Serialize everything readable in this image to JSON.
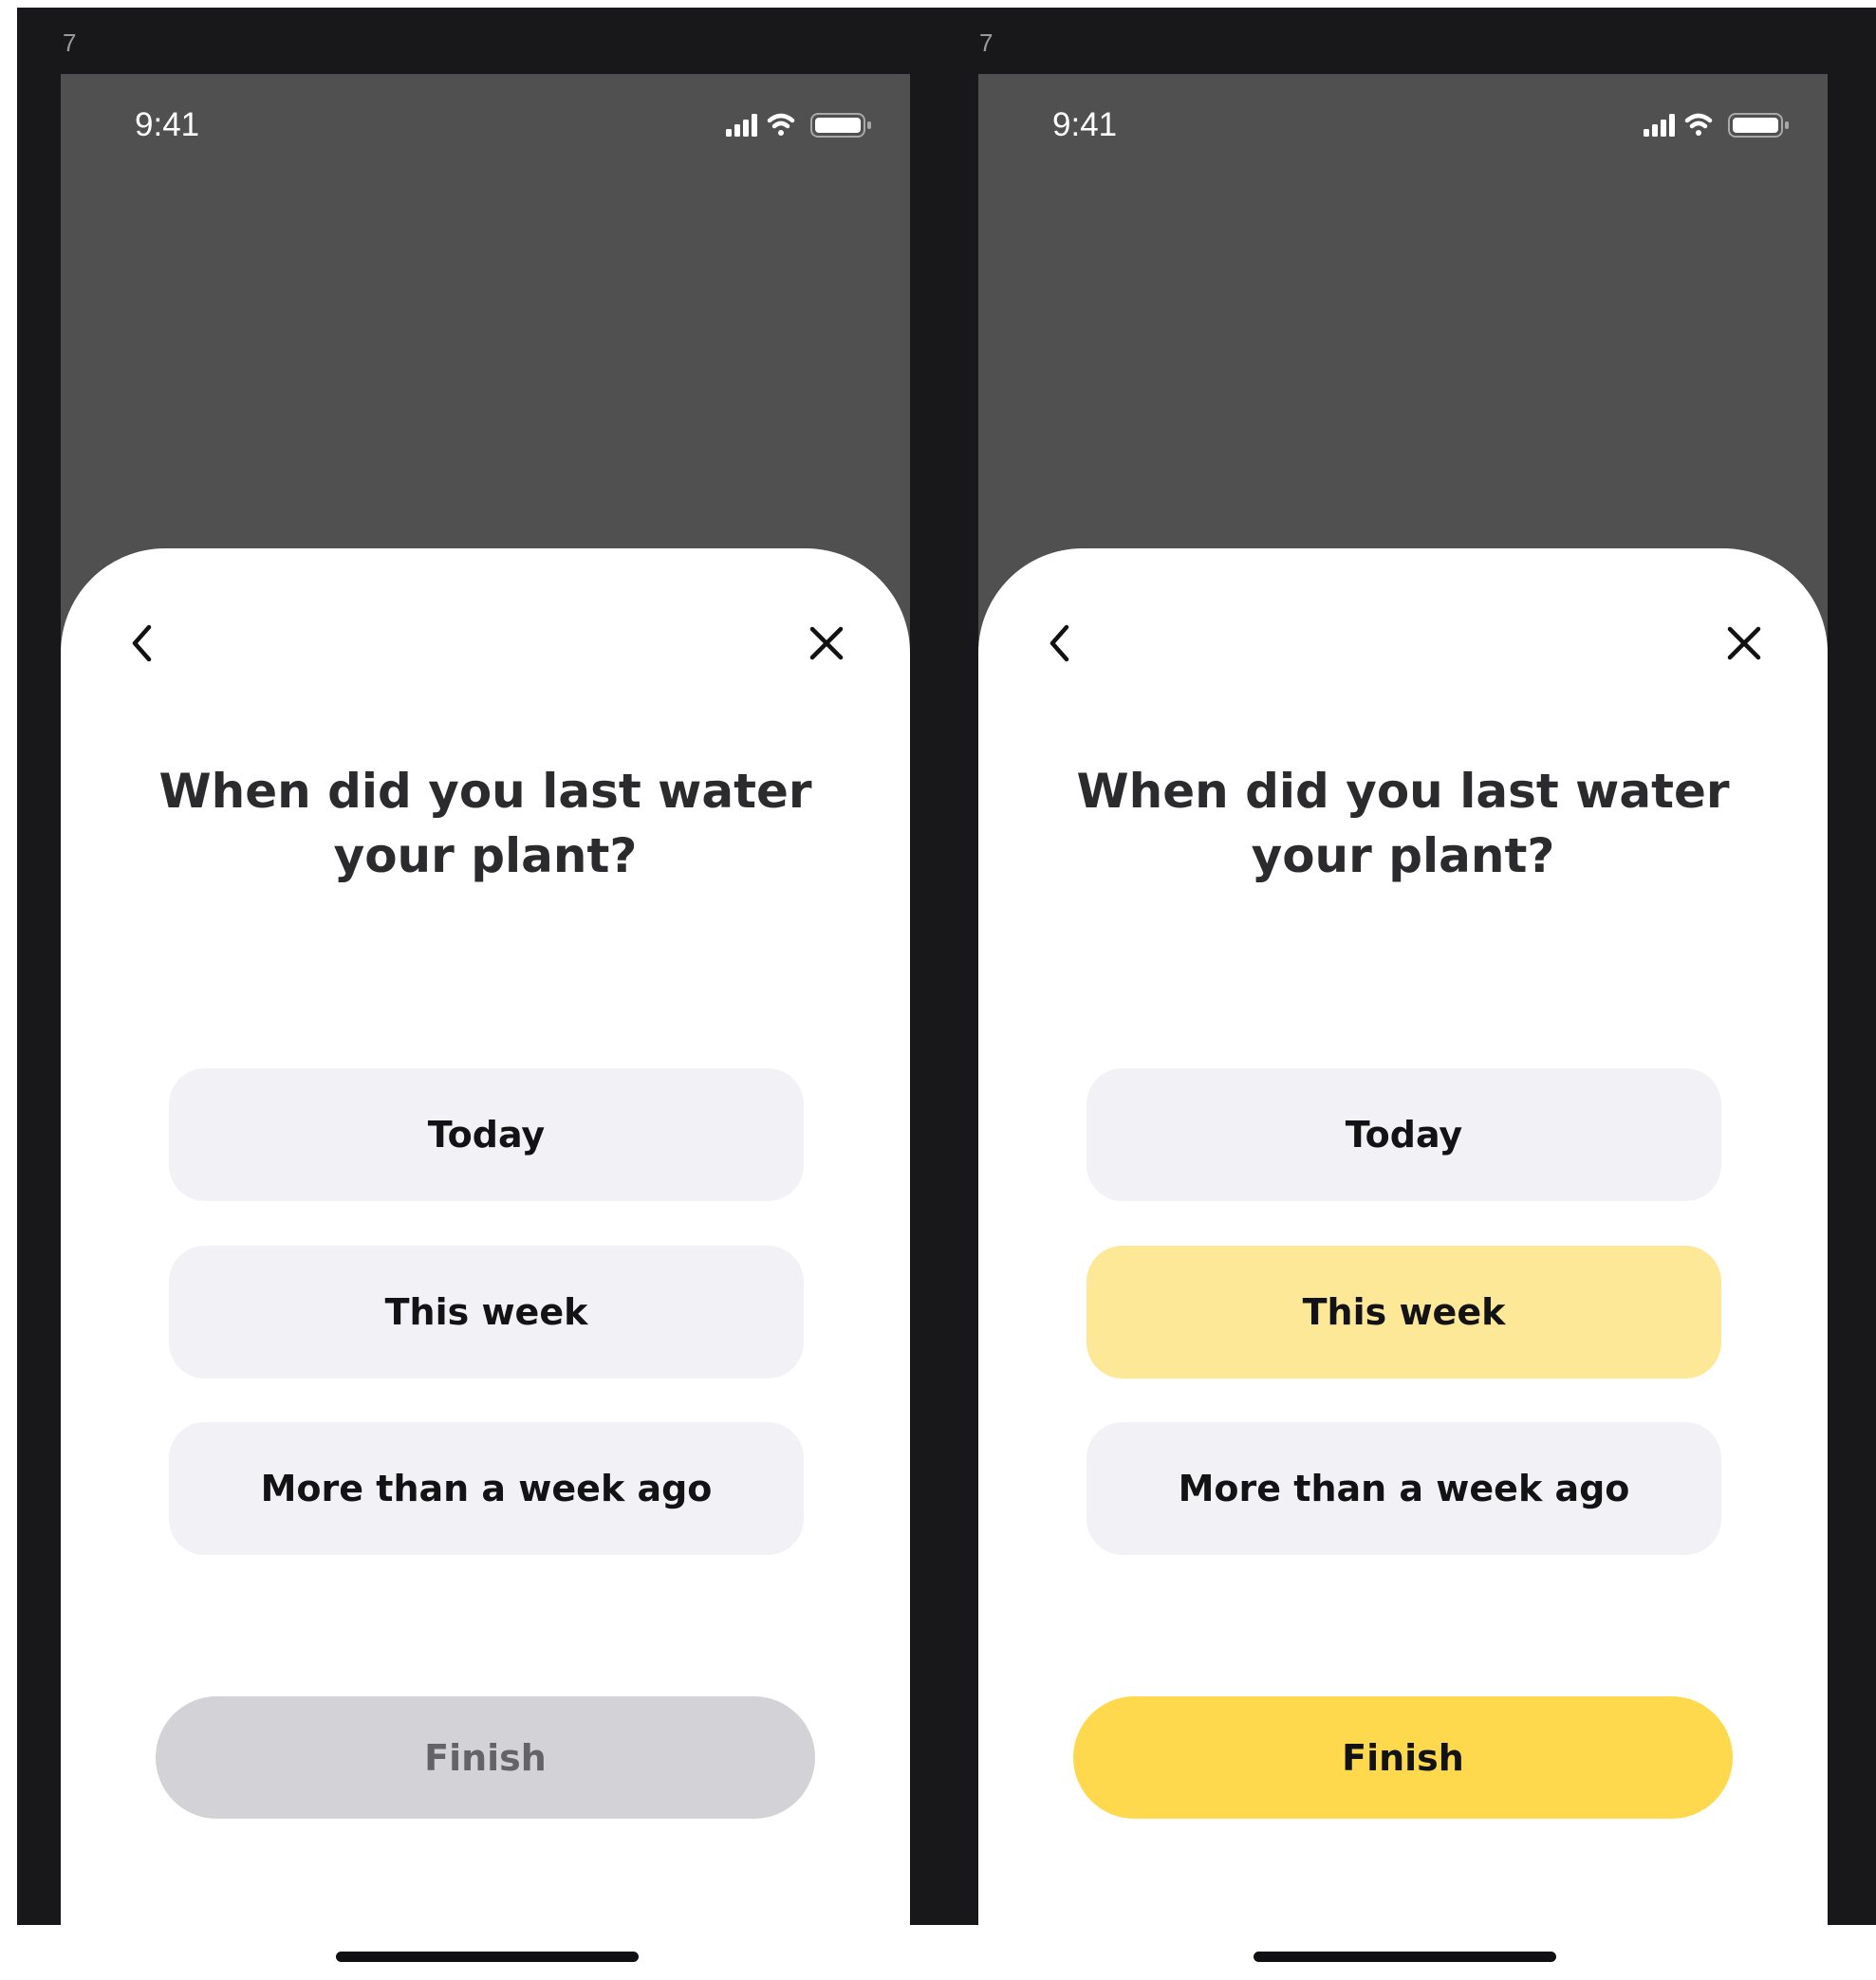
{
  "screens": [
    {
      "frame_label": "7",
      "status": {
        "time": "9:41"
      },
      "question": "When did you last water your plant?",
      "options": [
        {
          "label": "Today",
          "selected": false
        },
        {
          "label": "This week",
          "selected": false
        },
        {
          "label": "More than a week ago",
          "selected": false
        }
      ],
      "finish": {
        "label": "Finish",
        "state": "disabled"
      }
    },
    {
      "frame_label": "7",
      "status": {
        "time": "9:41"
      },
      "question": "When did you last water your plant?",
      "options": [
        {
          "label": "Today",
          "selected": false
        },
        {
          "label": "This week",
          "selected": true
        },
        {
          "label": "More than a week ago",
          "selected": false
        }
      ],
      "finish": {
        "label": "Finish",
        "state": "enabled"
      }
    }
  ],
  "colors": {
    "canvas_background": "#18181a",
    "backdrop": "#505050",
    "sheet": "#ffffff",
    "option_default": "#f1f1f6",
    "option_selected": "#fde897",
    "finish_disabled": "#d2d2d7",
    "finish_enabled": "#fed94d"
  },
  "icons": {
    "signal": "cellular-signal-icon",
    "wifi": "wifi-icon",
    "battery": "battery-icon",
    "back": "chevron-left-icon",
    "close": "close-icon"
  }
}
